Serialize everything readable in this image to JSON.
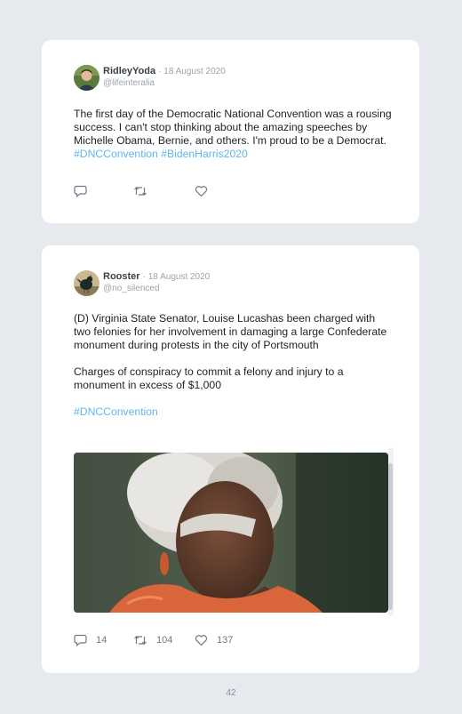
{
  "tweets": [
    {
      "name": "RidleyYoda",
      "date": "· 18 August 2020",
      "handle": "@lifeinteralia",
      "text": "The first day of the Democratic National Convention was a rousing success. I can't stop thinking about the amazing speeches by Michelle Obama, Bernie, and others. I'm proud to be a Democrat.",
      "hashtags": "#DNCConvention #BidenHarris2020",
      "icons": [
        "reply-icon",
        "retweet-icon",
        "like-icon"
      ]
    },
    {
      "name": "Rooster",
      "date": "· 18 August 2020",
      "handle": "@no_silenced",
      "paragraph1": "(D) Virginia State Senator, Louise Lucashas been charged with two felonies for her involvement in damaging a large Confederate monument during protests in the city of Portsmouth",
      "paragraph2": "Charges of conspiracy to commit a felony and injury to a monument in excess of $1,000",
      "hashtags": "#DNCConvention",
      "reply_count": "14",
      "retweet_count": "104",
      "like_count": "137",
      "icons": [
        "reply-icon",
        "retweet-icon",
        "like-icon"
      ]
    }
  ],
  "page_number": "42",
  "colors": {
    "background": "#e6e9ee",
    "card": "#ffffff",
    "hashtag": "#5fb6ec",
    "muted": "#9aa3ad"
  }
}
